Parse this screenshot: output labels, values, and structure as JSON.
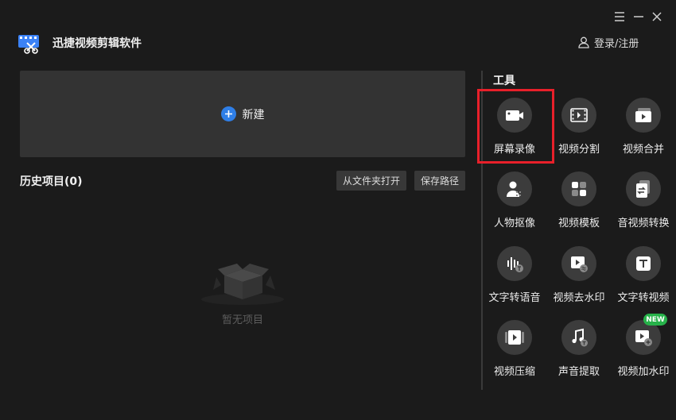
{
  "header": {
    "app_title": "迅捷视频剪辑软件",
    "login_label": "登录/注册"
  },
  "main": {
    "new_label": "新建",
    "history_title": "历史项目(0)",
    "open_folder_label": "从文件夹打开",
    "save_path_label": "保存路径",
    "empty_text": "暂无项目"
  },
  "tools": {
    "title": "工具",
    "items": [
      {
        "label": "屏幕录像",
        "icon": "camera-icon"
      },
      {
        "label": "视频分割",
        "icon": "film-split-icon"
      },
      {
        "label": "视频合并",
        "icon": "video-merge-icon"
      },
      {
        "label": "人物抠像",
        "icon": "person-cutout-icon"
      },
      {
        "label": "视频模板",
        "icon": "template-icon"
      },
      {
        "label": "音视频转换",
        "icon": "convert-icon"
      },
      {
        "label": "文字转语音",
        "icon": "text-to-speech-icon"
      },
      {
        "label": "视频去水印",
        "icon": "remove-watermark-icon"
      },
      {
        "label": "文字转视频",
        "icon": "text-to-video-icon"
      },
      {
        "label": "视频压缩",
        "icon": "video-compress-icon"
      },
      {
        "label": "声音提取",
        "icon": "audio-extract-icon"
      },
      {
        "label": "视频加水印",
        "icon": "add-watermark-icon"
      }
    ],
    "new_badge": "NEW"
  },
  "colors": {
    "background": "#1b1b1b",
    "panel": "#333333",
    "accent_blue": "#2f7fe8",
    "highlight_red": "#e8202a",
    "badge_green": "#27b24a"
  }
}
